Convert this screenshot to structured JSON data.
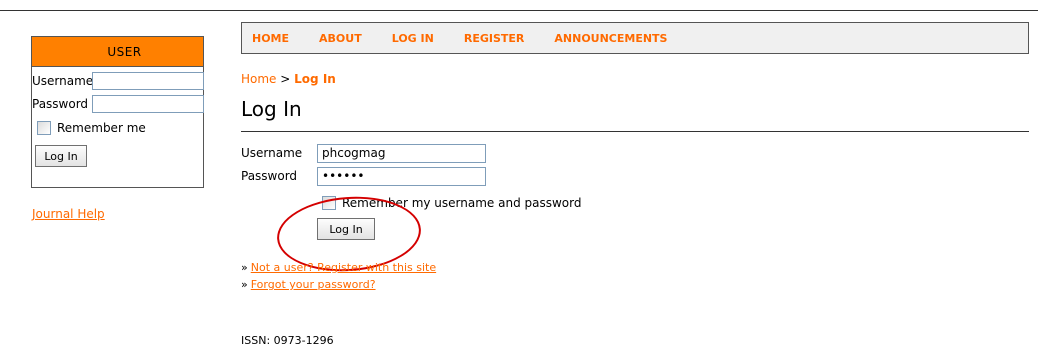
{
  "sidebar": {
    "title": "USER",
    "username_label": "Username",
    "password_label": "Password",
    "username_value": "",
    "password_value": "",
    "remember_label": "Remember me",
    "login_button": "Log In",
    "journal_help": "Journal Help"
  },
  "nav": {
    "items": [
      "HOME",
      "ABOUT",
      "LOG IN",
      "REGISTER",
      "ANNOUNCEMENTS"
    ]
  },
  "breadcrumb": {
    "home": "Home",
    "separator": ">",
    "current": "Log In"
  },
  "main": {
    "title": "Log In",
    "username_label": "Username",
    "username_value": "phcogmag",
    "password_label": "Password",
    "password_value": "••••••",
    "remember_label": "Remember my username and password",
    "login_button": "Log In",
    "register_link": "Not a user? Register with this site",
    "forgot_link": "Forgot your password?",
    "bullet": "»"
  },
  "footer": {
    "issn": "ISSN: 0973-1296"
  },
  "colors": {
    "accent": "#ff6a00",
    "sidebar_header": "#ff8000",
    "annotation": "#d40000"
  }
}
